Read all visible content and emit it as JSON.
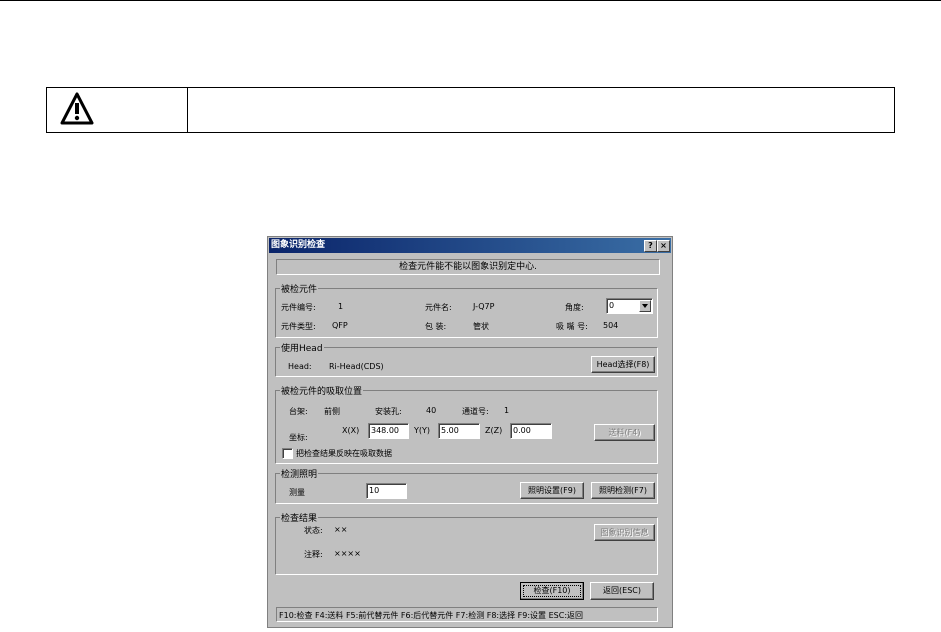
{
  "dialog": {
    "title": "图象识别检查",
    "help_label": "?",
    "close_label": "×",
    "message": "检查元件能不能以图象识别定中心."
  },
  "component_group": {
    "title": "被检元件",
    "number_label": "元件编号:",
    "number_value": "1",
    "name_label": "元件名:",
    "name_value": "J-Q7P",
    "angle_label": "角度:",
    "angle_value": "0",
    "type_label": "元件类型:",
    "type_value": "QFP",
    "package_label": "包  装:",
    "package_value": "管状",
    "nozzle_label": "吸 嘴 号:",
    "nozzle_value": "504"
  },
  "head_group": {
    "title": "使用Head",
    "head_label": "Head:",
    "head_value": "Ri-Head(CDS)",
    "select_button": "Head选择(F8)"
  },
  "pickup_group": {
    "title": "被检元件的吸取位置",
    "rack_label": "台架:",
    "rack_value": "前侧",
    "hole_label": "安装孔:",
    "hole_value": "40",
    "channel_label": "通道号:",
    "channel_value": "1",
    "coord_label": "坐标:",
    "x_label": "X(X)",
    "x_value": "348.00",
    "y_label": "Y(Y)",
    "y_value": "5.00",
    "z_label": "Z(Z)",
    "z_value": "0.00",
    "feed_button": "送料(F4)",
    "reflect_checkbox": "把检查结果反映在吸取数据",
    "reflect_checked": false
  },
  "lighting_group": {
    "title": "检测照明",
    "measure_label": "测量",
    "measure_value": "10",
    "setup_button": "照明设置(F9)",
    "detect_button": "照明检测(F7)"
  },
  "result_group": {
    "title": "检查结果",
    "status_label": "状态:",
    "status_value": "××",
    "note_label": "注释:",
    "note_value": "××××",
    "info_button": "图象识别信息"
  },
  "actions": {
    "check_button": "检查(F10)",
    "back_button": "返回(ESC)"
  },
  "status_bar": "F10:检查 F4:送料 F5:前代替元件 F6:后代替元件 F7:检测 F8:选择 F9:设置 ESC:返回"
}
